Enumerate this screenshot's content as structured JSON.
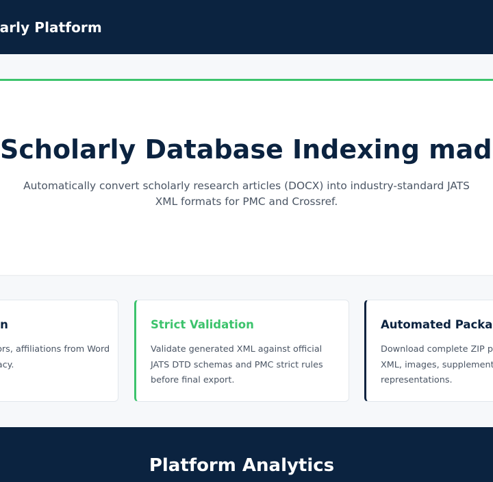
{
  "navbar": {
    "brand": "Scholarly Platform"
  },
  "hero": {
    "title": "Scholarly Database Indexing made simple",
    "description": "Automatically convert scholarly research articles (DOCX) into industry-standard JATS XML formats for PMC and Crossref."
  },
  "features": [
    {
      "title": "Metadata Extraction",
      "description": "Extract title, abstract, authors, affiliations from Word documents with high accuracy."
    },
    {
      "title": "Strict Validation",
      "description": "Validate generated XML against official JATS DTD schemas and PMC strict rules before final export."
    },
    {
      "title": "Automated Packaging",
      "description": "Download complete ZIP packages containing XML, images, supplementary files, and PDF representations."
    }
  ],
  "analytics": {
    "title": "Platform Analytics"
  },
  "colors": {
    "navy": "#0b2340",
    "accent_green": "#3cc36c",
    "background": "#f6f8fa"
  }
}
